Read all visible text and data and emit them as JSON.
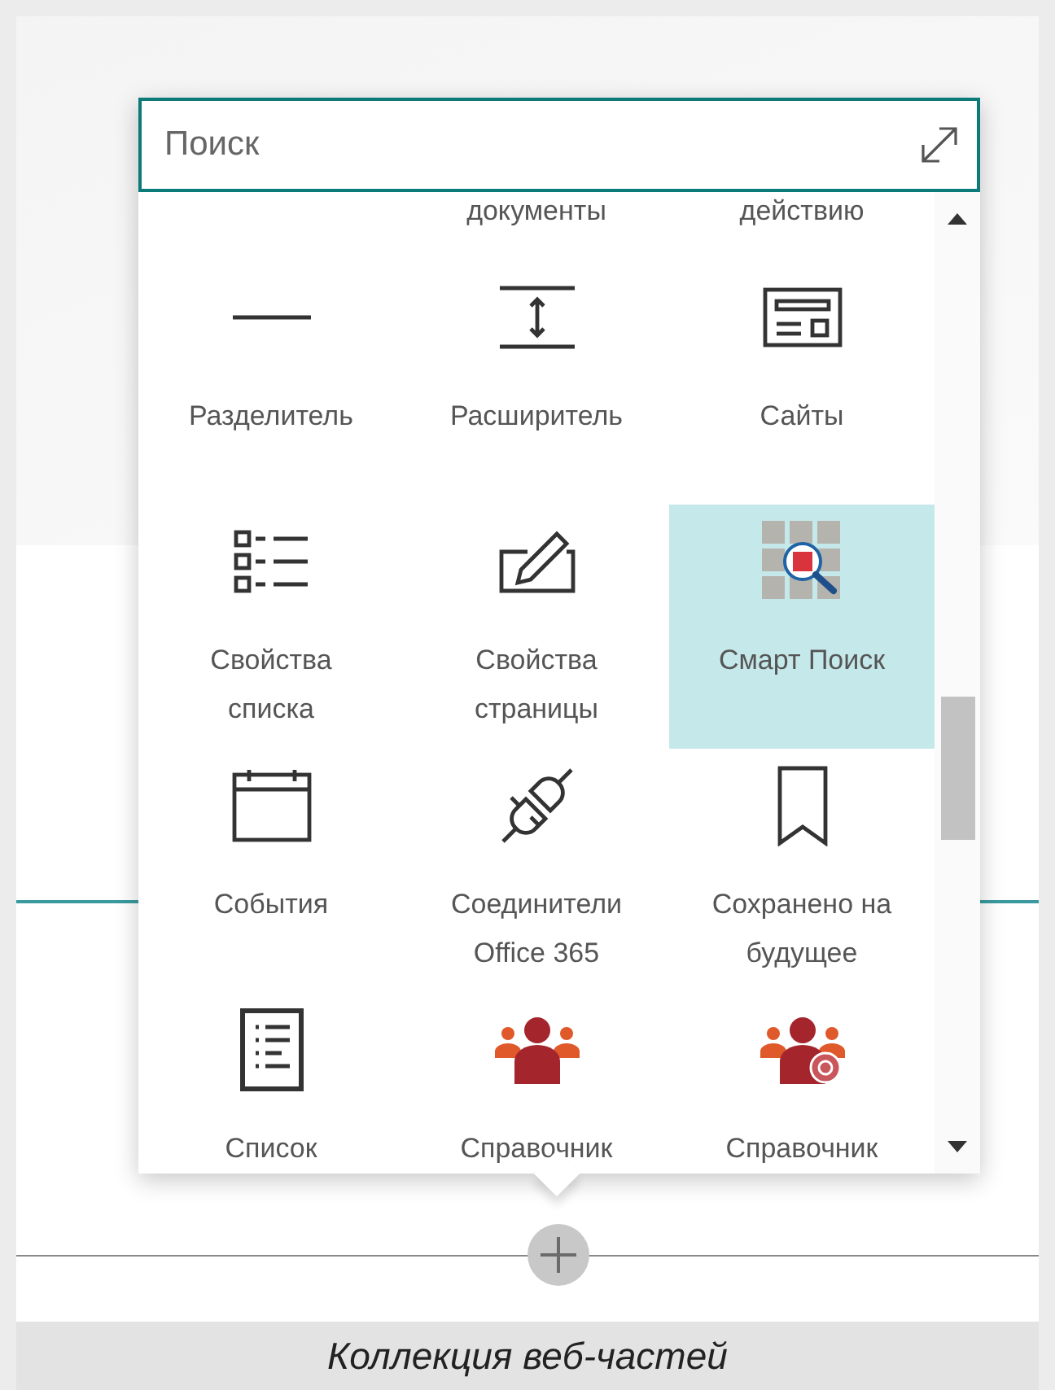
{
  "search": {
    "placeholder": "Поиск"
  },
  "cut_row_labels": [
    "документы",
    "действию"
  ],
  "items": [
    {
      "label": "Разделитель",
      "kind": "divider",
      "selected": false
    },
    {
      "label": "Расширитель",
      "kind": "spacer",
      "selected": false
    },
    {
      "label": "Сайты",
      "kind": "sites",
      "selected": false
    },
    {
      "label": "Свойства списка",
      "kind": "listprops",
      "selected": false
    },
    {
      "label": "Свойства страницы",
      "kind": "pageprops",
      "selected": false
    },
    {
      "label": "Смарт Поиск",
      "kind": "smartsearch",
      "selected": true
    },
    {
      "label": "События",
      "kind": "events",
      "selected": false
    },
    {
      "label": "Соединители Office 365",
      "kind": "connector",
      "selected": false
    },
    {
      "label": "Сохранено на будущее",
      "kind": "bookmark",
      "selected": false
    },
    {
      "label": "Список",
      "kind": "list",
      "selected": false
    },
    {
      "label": "Справочник",
      "kind": "people",
      "selected": false
    },
    {
      "label": "Справочник",
      "kind": "peoplebadge",
      "selected": false
    }
  ],
  "caption": "Коллекция веб-частей"
}
